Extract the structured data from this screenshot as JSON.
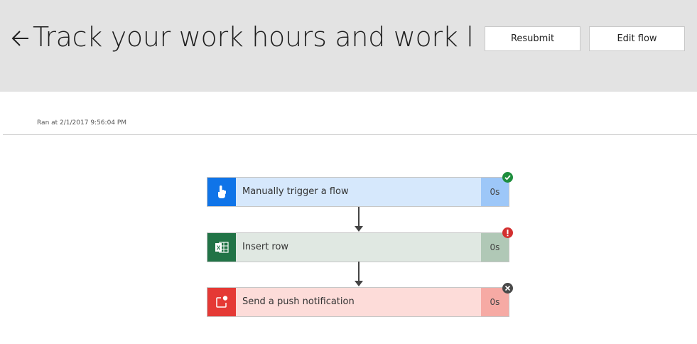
{
  "header": {
    "title": "Track your work hours and work lo...",
    "back_icon": "arrow-left-icon",
    "resubmit_label": "Resubmit",
    "edit_flow_label": "Edit flow"
  },
  "run": {
    "ran_at": "Ran at 2/1/2017 9:56:04 PM"
  },
  "steps": [
    {
      "label": "Manually trigger a flow",
      "duration": "0s",
      "icon": "hand-pointer-icon",
      "status": "succeeded",
      "status_icon": "check-icon",
      "colors": {
        "icon_bg": "#0f74e8",
        "body": "#d6e8fc",
        "duration_bg": "#9dc7f8",
        "status": "#1e8e3e"
      }
    },
    {
      "label": "Insert row",
      "duration": "0s",
      "icon": "excel-icon",
      "status": "failed",
      "status_icon": "exclamation-icon",
      "colors": {
        "icon_bg": "#217346",
        "body": "#e0e8e2",
        "duration_bg": "#b0c8b6",
        "status": "#d32f2f"
      }
    },
    {
      "label": "Send a push notification",
      "duration": "0s",
      "icon": "notification-icon",
      "status": "cancelled",
      "status_icon": "close-icon",
      "colors": {
        "icon_bg": "#e53935",
        "body": "#fddcd9",
        "duration_bg": "#f6aaa4",
        "status": "#4a4a4a"
      }
    }
  ]
}
